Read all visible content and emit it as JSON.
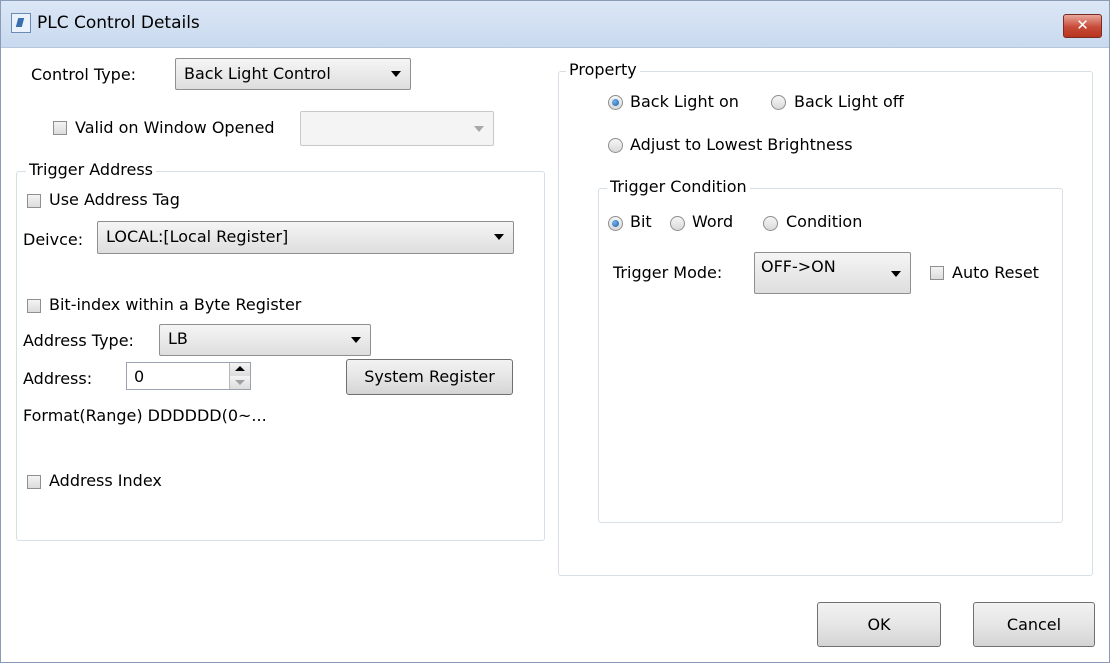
{
  "window": {
    "title": "PLC Control Details",
    "close_glyph": "✕"
  },
  "control_type": {
    "label": "Control Type:",
    "value": "Back Light Control"
  },
  "valid_on_window_opened": {
    "label": "Valid on Window Opened",
    "checked": false,
    "combo_value": ""
  },
  "trigger_address": {
    "title": "Trigger Address",
    "use_address_tag": "Use Address Tag",
    "device_label": "Deivce:",
    "device_value": "LOCAL:[Local Register]",
    "bit_index": "Bit-index within a Byte Register",
    "address_type_label": "Address Type:",
    "address_type_value": "LB",
    "address_label": "Address:",
    "address_value": "0",
    "system_register": "System Register",
    "format_text": "Format(Range) DDDDDD(0~...",
    "address_index": "Address Index"
  },
  "property": {
    "title": "Property",
    "back_light_on": "Back Light on",
    "back_light_off": "Back Light off",
    "adjust_lowest": "Adjust to Lowest Brightness",
    "selected": "Back Light on"
  },
  "trigger_condition": {
    "title": "Trigger Condition",
    "bit": "Bit",
    "word": "Word",
    "condition": "Condition",
    "selected": "Bit",
    "mode_label": "Trigger Mode:",
    "mode_value": "OFF->ON",
    "auto_reset": "Auto Reset"
  },
  "buttons": {
    "ok": "OK",
    "cancel": "Cancel"
  },
  "colors": {
    "close_red": "#c84a38",
    "radio_blue": "#1f5fa8",
    "titlebar": "#d4e2f3"
  },
  "icons": [
    "app-icon",
    "close-icon",
    "dropdown-arrow-icon",
    "spin-up-icon",
    "spin-down-icon"
  ]
}
